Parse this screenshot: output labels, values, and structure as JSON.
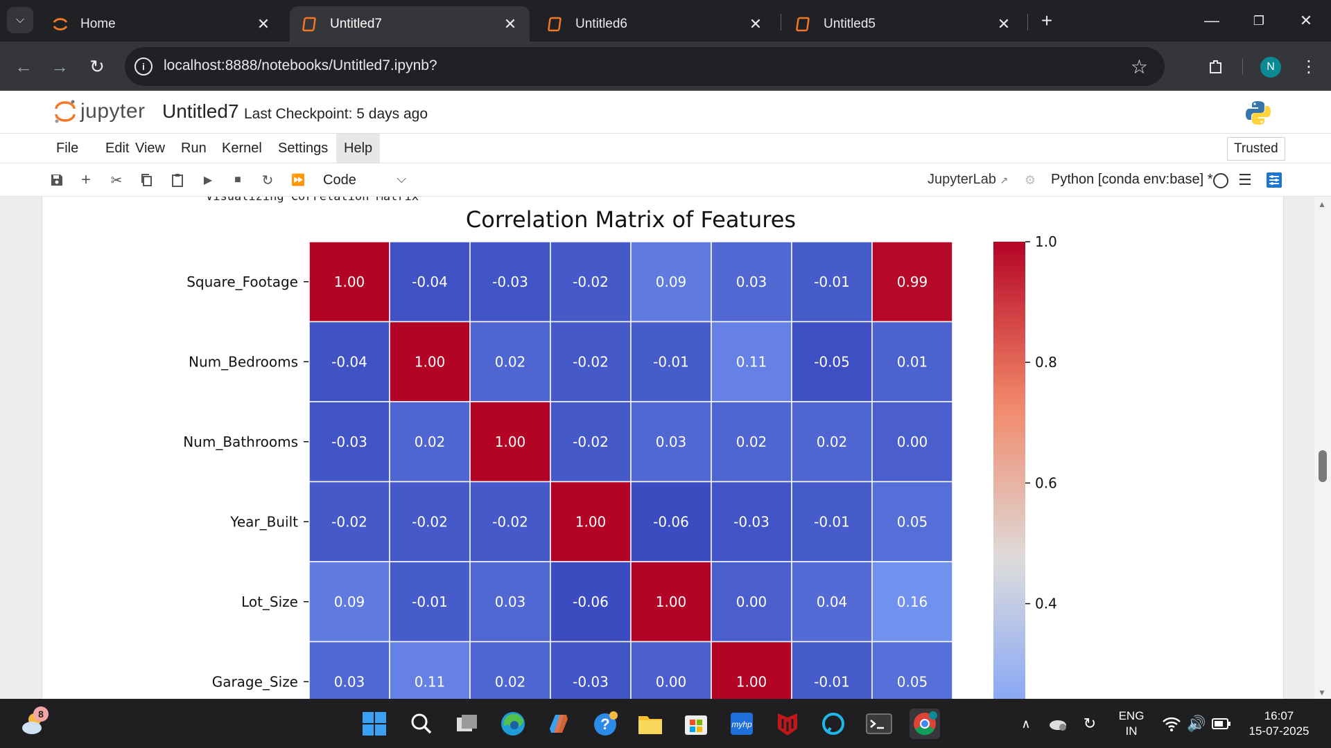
{
  "browser": {
    "tabs": [
      {
        "label": "Home",
        "active": false
      },
      {
        "label": "Untitled7",
        "active": true
      },
      {
        "label": "Untitled6",
        "active": false
      },
      {
        "label": "Untitled5",
        "active": false
      }
    ],
    "url": "localhost:8888/notebooks/Untitled7.ipynb?",
    "profile_initial": "N"
  },
  "jupyter": {
    "logo_text": "jupyter",
    "notebook_title": "Untitled7",
    "checkpoint": "Last Checkpoint: 5 days ago",
    "menu": [
      "File",
      "Edit",
      "View",
      "Run",
      "Kernel",
      "Settings",
      "Help"
    ],
    "trusted_label": "Trusted",
    "cell_type": "Code",
    "jupyterlab_link": "JupyterLab",
    "kernel": "Python [conda env:base] *"
  },
  "output": {
    "cut_text": "Visualizing Correlation Matrix"
  },
  "chart_data": {
    "type": "heatmap",
    "title": "Correlation Matrix of Features",
    "row_labels": [
      "Square_Footage",
      "Num_Bedrooms",
      "Num_Bathrooms",
      "Year_Built",
      "Lot_Size",
      "Garage_Size"
    ],
    "values": [
      [
        1.0,
        -0.04,
        -0.03,
        -0.02,
        0.09,
        0.03,
        -0.01,
        0.99
      ],
      [
        -0.04,
        1.0,
        0.02,
        -0.02,
        -0.01,
        0.11,
        -0.05,
        0.01
      ],
      [
        -0.03,
        0.02,
        1.0,
        -0.02,
        0.03,
        0.02,
        0.02,
        -0.0
      ],
      [
        -0.02,
        -0.02,
        -0.02,
        1.0,
        -0.06,
        -0.03,
        -0.01,
        0.05
      ],
      [
        0.09,
        -0.01,
        0.03,
        -0.06,
        1.0,
        0.0,
        0.04,
        0.16
      ],
      [
        0.03,
        0.11,
        0.02,
        -0.03,
        0.0,
        1.0,
        -0.01,
        0.05
      ]
    ],
    "colorbar_ticks": [
      "1.0",
      "0.8",
      "0.6",
      "0.4"
    ],
    "colormap": "coolwarm",
    "vmin": -0.06,
    "vmax": 1.0
  },
  "taskbar": {
    "weather_badge": "8",
    "lang_top": "ENG",
    "lang_bottom": "IN",
    "time": "16:07",
    "date": "15-07-2025"
  }
}
